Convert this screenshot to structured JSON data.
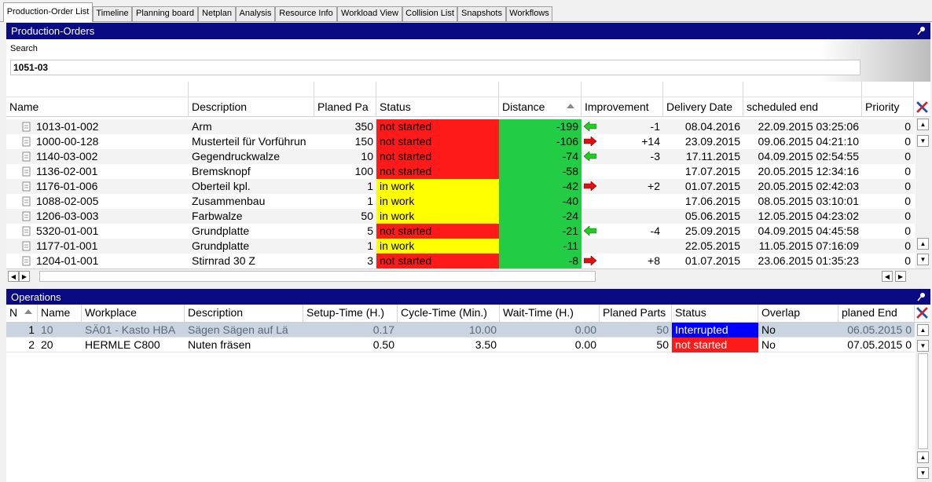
{
  "tabs": [
    "Production-Order List",
    "Timeline",
    "Planning board",
    "Netplan",
    "Analysis",
    "Resource Info",
    "Workload View",
    "Collision List",
    "Snapshots",
    "Workflows"
  ],
  "colors": {
    "red": "#ff1a1a",
    "green": "#22cc44",
    "yellow": "#ffff00",
    "blue": "#0000ff",
    "title": "#0a0a82"
  },
  "orders": {
    "title": "Production-Orders",
    "search_label": "Search",
    "search_value": "1051-03",
    "columns": [
      "Name",
      "Description",
      "Planed Pa",
      "Status",
      "Distance",
      "Improvement",
      "Delivery Date",
      "scheduled end",
      "Priority"
    ],
    "rows": [
      {
        "name": "1013-01-002",
        "desc": "Arm",
        "parts": "350",
        "status": "not started",
        "status_color": "red",
        "dist": "-199",
        "arrow": "left",
        "impr": "-1",
        "delivery": "08.04.2016",
        "end": "22.09.2015 03:25:06",
        "prio": "0"
      },
      {
        "name": "1000-00-128",
        "desc": "Musterteil für Vorführun",
        "parts": "150",
        "status": "not started",
        "status_color": "red",
        "dist": "-106",
        "arrow": "right",
        "impr": "+14",
        "delivery": "23.09.2015",
        "end": "09.06.2015 04:21:10",
        "prio": "0"
      },
      {
        "name": "1140-03-002",
        "desc": "Gegendruckwalze",
        "parts": "10",
        "status": "not started",
        "status_color": "red",
        "dist": "-74",
        "arrow": "left",
        "impr": "-3",
        "delivery": "17.11.2015",
        "end": "04.09.2015 02:54:55",
        "prio": "0"
      },
      {
        "name": "1136-02-001",
        "desc": "Bremsknopf",
        "parts": "100",
        "status": "not started",
        "status_color": "red",
        "dist": "-58",
        "arrow": "",
        "impr": "",
        "delivery": "17.07.2015",
        "end": "20.05.2015 12:34:16",
        "prio": "0"
      },
      {
        "name": "1176-01-006",
        "desc": "Oberteil kpl.",
        "parts": "1",
        "status": "in work",
        "status_color": "yellow",
        "dist": "-42",
        "arrow": "right",
        "impr": "+2",
        "delivery": "01.07.2015",
        "end": "20.05.2015 02:42:03",
        "prio": "0"
      },
      {
        "name": "1088-02-005",
        "desc": "Zusammenbau",
        "parts": "1",
        "status": "in work",
        "status_color": "yellow",
        "dist": "-40",
        "arrow": "",
        "impr": "",
        "delivery": "17.06.2015",
        "end": "08.05.2015 03:10:01",
        "prio": "0"
      },
      {
        "name": "1206-03-003",
        "desc": "Farbwalze",
        "parts": "50",
        "status": "in work",
        "status_color": "yellow",
        "dist": "-24",
        "arrow": "",
        "impr": "",
        "delivery": "05.06.2015",
        "end": "12.05.2015 04:23:02",
        "prio": "0"
      },
      {
        "name": "5320-01-001",
        "desc": "Grundplatte",
        "parts": "5",
        "status": "not started",
        "status_color": "red",
        "dist": "-21",
        "arrow": "left",
        "impr": "-4",
        "delivery": "25.09.2015",
        "end": "04.09.2015 04:45:58",
        "prio": "0"
      },
      {
        "name": "1177-01-001",
        "desc": "Grundplatte",
        "parts": "1",
        "status": "in work",
        "status_color": "yellow",
        "dist": "-11",
        "arrow": "",
        "impr": "",
        "delivery": "22.05.2015",
        "end": "11.05.2015 07:16:09",
        "prio": "0"
      },
      {
        "name": "1204-01-001",
        "desc": "Stirnrad 30 Z",
        "parts": "3",
        "status": "not started",
        "status_color": "red",
        "dist": "-8",
        "arrow": "right",
        "impr": "+8",
        "delivery": "01.07.2015",
        "end": "23.06.2015 01:35:23",
        "prio": "0"
      }
    ]
  },
  "operations": {
    "title": "Operations",
    "columns": [
      "N",
      "Name",
      "Workplace",
      "Description",
      "Setup-Time (H.)",
      "Cycle-Time (Min.)",
      "Wait-Time (H.)",
      "Planed Parts",
      "Status",
      "Overlap",
      "planed End"
    ],
    "rows": [
      {
        "n": "1",
        "name": "10",
        "workplace": "SÄ01 - Kasto  HBA",
        "desc": "Sägen  Sägen auf Lä",
        "setup": "0.17",
        "cycle": "10.00",
        "wait": "0.00",
        "parts": "50",
        "status": "Interrupted",
        "status_color": "blue",
        "overlap": "No",
        "end": "06.05.2015 0"
      },
      {
        "n": "2",
        "name": "20",
        "workplace": "HERMLE C800",
        "desc": "Nuten fräsen",
        "setup": "0.50",
        "cycle": "3.50",
        "wait": "0.00",
        "parts": "50",
        "status": "not started",
        "status_color": "red",
        "overlap": "No",
        "end": "07.05.2015 0"
      }
    ]
  }
}
